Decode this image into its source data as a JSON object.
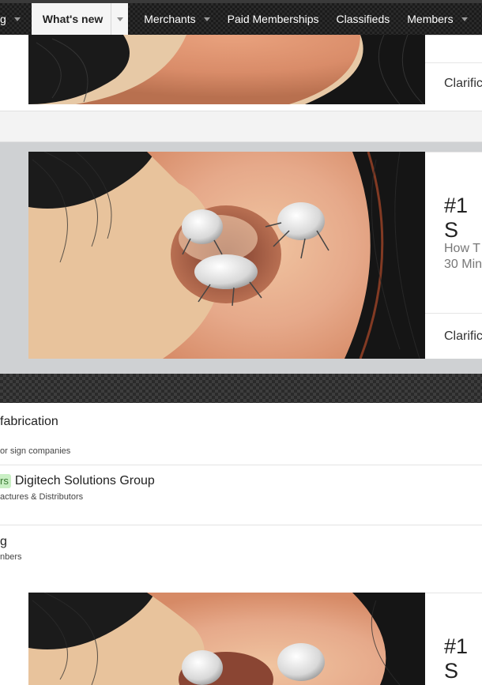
{
  "nav": {
    "items": [
      {
        "label": "g"
      },
      {
        "label": "What's new"
      },
      {
        "label": "Merchants"
      },
      {
        "label": "Paid Memberships"
      },
      {
        "label": "Classifieds"
      },
      {
        "label": "Members"
      }
    ]
  },
  "ads": [
    {
      "headline": "",
      "description": "",
      "footer": "Clarific"
    },
    {
      "headline": "#1 S",
      "description": "How T 30 Min",
      "footer": "Clarific"
    },
    {
      "headline": "#1 S",
      "description": "",
      "footer": ""
    }
  ],
  "directory": {
    "rows": [
      {
        "title": "fabrication",
        "subtitle": "or sign companies",
        "badge": ""
      },
      {
        "title": "Digitech Solutions Group",
        "subtitle": "actures & Distributors",
        "badge": "rs"
      },
      {
        "title": "g",
        "subtitle": "nbers",
        "badge": ""
      }
    ]
  },
  "colors": {
    "nav_bg": "#1b1b1b",
    "active_tab_bg": "#f5f5f5",
    "badge_bg": "#c9efc4",
    "band_gray": "#cfd1d3"
  }
}
